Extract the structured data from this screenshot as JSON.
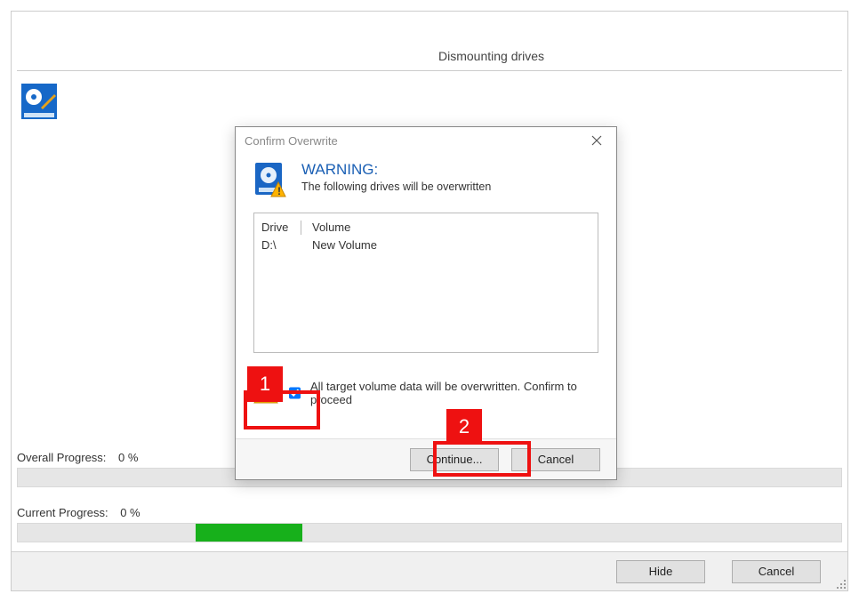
{
  "main": {
    "header": "Dismounting drives",
    "overall_label": "Overall Progress:",
    "overall_pct": "0 %",
    "current_label": "Current Progress:",
    "current_pct": "0 %",
    "hide_btn": "Hide",
    "cancel_btn": "Cancel"
  },
  "dialog": {
    "title": "Confirm Overwrite",
    "warning_heading": "WARNING:",
    "warning_sub": "The following drives will be overwritten",
    "col_drive": "Drive",
    "col_volume": "Volume",
    "row_drive": "D:\\",
    "row_volume": "New Volume",
    "confirm_text": "All target volume data will be overwritten. Confirm to proceed",
    "continue_btn": "Continue...",
    "cancel_btn": "Cancel"
  },
  "annotations": {
    "one": "1",
    "two": "2"
  }
}
